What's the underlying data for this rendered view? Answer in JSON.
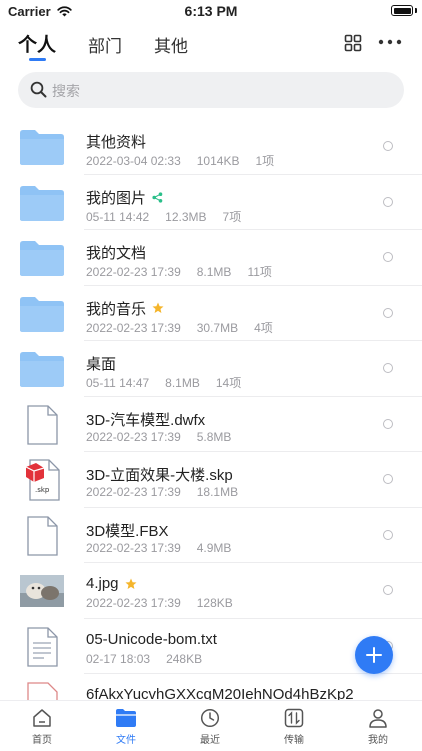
{
  "status_bar": {
    "carrier": "Carrier",
    "time": "6:13 PM"
  },
  "top_tabs": [
    {
      "label": "个人",
      "active": true
    },
    {
      "label": "部门",
      "active": false
    },
    {
      "label": "其他",
      "active": false
    }
  ],
  "search": {
    "placeholder": "搜索"
  },
  "files": [
    {
      "name": "其他资料",
      "date": "2022-03-04 02:33",
      "size": "1014KB",
      "count": "1项",
      "icon": "folder-icon"
    },
    {
      "name": "我的图片",
      "date": "05-11 14:42",
      "size": "12.3MB",
      "count": "7项",
      "icon": "folder-icon",
      "badge": "share-icon"
    },
    {
      "name": "我的文档",
      "date": "2022-02-23 17:39",
      "size": "8.1MB",
      "count": "11项",
      "icon": "folder-icon"
    },
    {
      "name": "我的音乐",
      "date": "2022-02-23 17:39",
      "size": "30.7MB",
      "count": "4项",
      "icon": "folder-icon",
      "badge": "star-icon"
    },
    {
      "name": "桌面",
      "date": "05-11 14:47",
      "size": "8.1MB",
      "count": "14项",
      "icon": "folder-icon"
    },
    {
      "name": "3D-汽车模型.dwfx",
      "date": "2022-02-23 17:39",
      "size": "5.8MB",
      "icon": "document-icon"
    },
    {
      "name": "3D-立面效果-大楼.skp",
      "date": "2022-02-23 17:39",
      "size": "18.1MB",
      "icon": "skp-file-icon"
    },
    {
      "name": "3D模型.FBX",
      "date": "2022-02-23 17:39",
      "size": "4.9MB",
      "icon": "document-icon"
    },
    {
      "name": "4.jpg",
      "date": "2022-02-23 17:39",
      "size": "128KB",
      "icon": "image-thumbnail",
      "badge": "star-icon"
    },
    {
      "name": "05-Unicode-bom.txt",
      "date": "02-17 18:03",
      "size": "248KB",
      "icon": "text-file-icon"
    },
    {
      "name": "6fAkxYucvhGXXcqM20IehNOd4hBzKp2",
      "date": "",
      "size": "",
      "icon": "document-icon"
    }
  ],
  "bottom_tabs": [
    {
      "label": "首页",
      "icon": "home-icon",
      "active": false
    },
    {
      "label": "文件",
      "icon": "folder-icon",
      "active": true
    },
    {
      "label": "最近",
      "icon": "clock-icon",
      "active": false
    },
    {
      "label": "传输",
      "icon": "transfer-icon",
      "active": false
    },
    {
      "label": "我的",
      "icon": "user-icon",
      "active": false
    }
  ],
  "colors": {
    "accent": "#2f7bf5",
    "folder": "#8fc3f5",
    "star": "#f5b52b",
    "share": "#2bbf8a"
  }
}
